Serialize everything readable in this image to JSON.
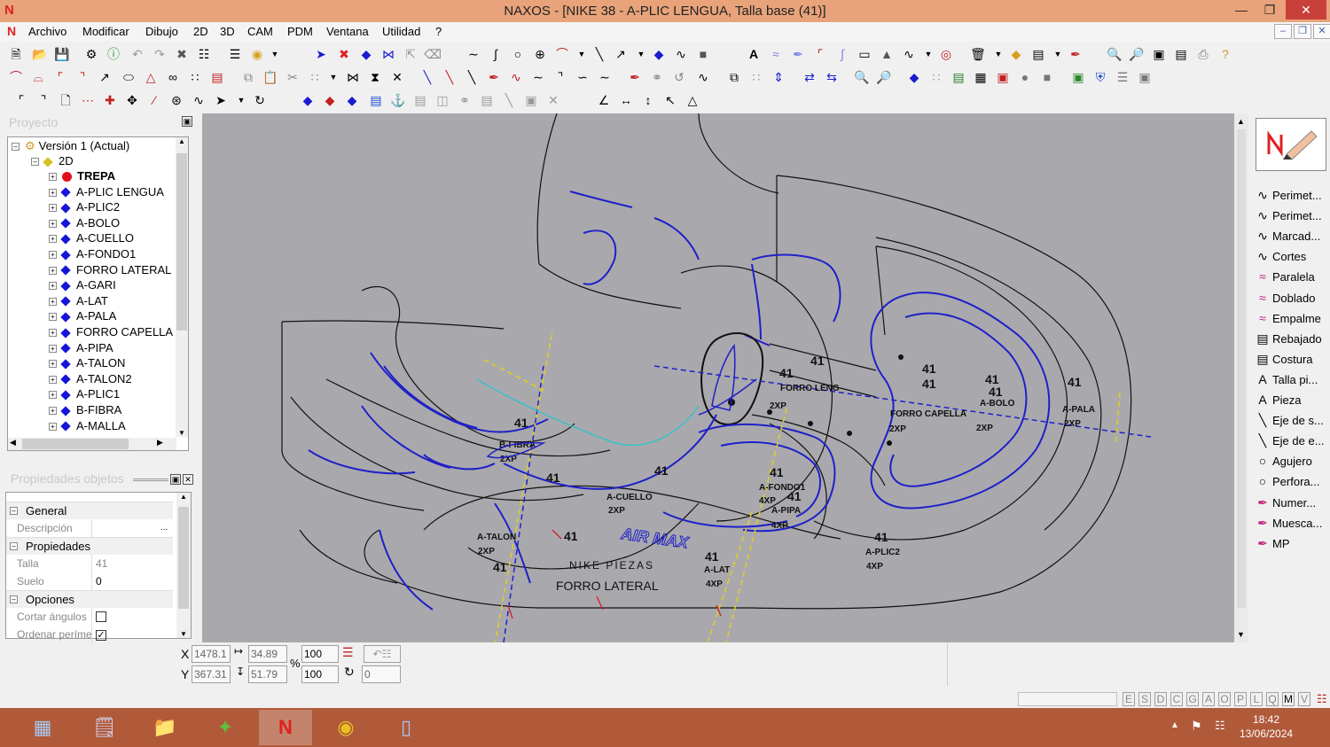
{
  "window": {
    "title": "NAXOS - [NIKE 38 - A-PLIC LENGUA, Talla base (41)]",
    "app_icon": "N"
  },
  "menu": [
    "Archivo",
    "Modificar",
    "Dibujo",
    "2D",
    "3D",
    "CAM",
    "PDM",
    "Ventana",
    "Utilidad",
    "?"
  ],
  "project_panel": {
    "title": "Proyecto",
    "version": "Versión 1 (Actual)",
    "group": "2D",
    "items": [
      "TREPA",
      "A-PLIC LENGUA",
      "A-PLIC2",
      "A-BOLO",
      "A-CUELLO",
      "A-FONDO1",
      "FORRO LATERAL",
      "A-GARI",
      "A-LAT",
      "A-PALA",
      "FORRO CAPELLA",
      "A-PIPA",
      "A-TALON",
      "A-TALON2",
      "A-PLIC1",
      "B-FIBRA",
      "A-MALLA"
    ]
  },
  "props_panel": {
    "title": "Propiedades objetos",
    "cat_general": "General",
    "descripcion_label": "Descripción",
    "descripcion_value": "",
    "cat_propiedades": "Propiedades",
    "talla_label": "Talla",
    "talla_value": "41",
    "suelo_label": "Suelo",
    "suelo_value": "0",
    "cat_opciones": "Opciones",
    "cortar_label": "Cortar ángulos",
    "ordenar_label": "Ordenar perímetro",
    "cortar_checked": false,
    "ordenar_checked": true
  },
  "right_tools": [
    "Perimet...",
    "Perimet...",
    "Marcad...",
    "Cortes",
    "Paralela",
    "Doblado",
    "Empalme",
    "Rebajado",
    "Costura",
    "Talla pi...",
    "Pieza",
    "Eje de s...",
    "Eje de e...",
    "Agujero",
    "Perfora...",
    "Numer...",
    "Muesca...",
    "MP"
  ],
  "coords": {
    "x": "1478.1",
    "y": "367.31",
    "dx": "34.89",
    "dy": "51.79",
    "scale_x": "100",
    "scale_y": "100",
    "rotation": "0",
    "percent": "%"
  },
  "status_letters": [
    "E",
    "S",
    "D",
    "C",
    "G",
    "A",
    "O",
    "P",
    "L",
    "Q",
    "M",
    "V"
  ],
  "drawing_labels": {
    "air_max": "AIR MAX",
    "nike_piezas": "NIKE PIEZAS",
    "forro_lateral": "FORRO LATERAL",
    "forro_capella": "FORRO CAPELLA",
    "a_pala": "A-PALA",
    "a_bolo": "A-BOLO",
    "a_cuello": "A-CUELLO",
    "a_fondo1": "A-FONDO1",
    "a_pipa": "A-PIPA",
    "a_talon": "A-TALON",
    "a_lat": "A-LAT",
    "a_plic2": "A-PLIC2",
    "b_fibra": "B-FIBRA",
    "forro_lengua": "FORRO LENG",
    "size": "41",
    "q2": "2XP",
    "q4": "4XP"
  },
  "taskbar": {
    "time": "18:42",
    "date": "13/06/2024"
  }
}
